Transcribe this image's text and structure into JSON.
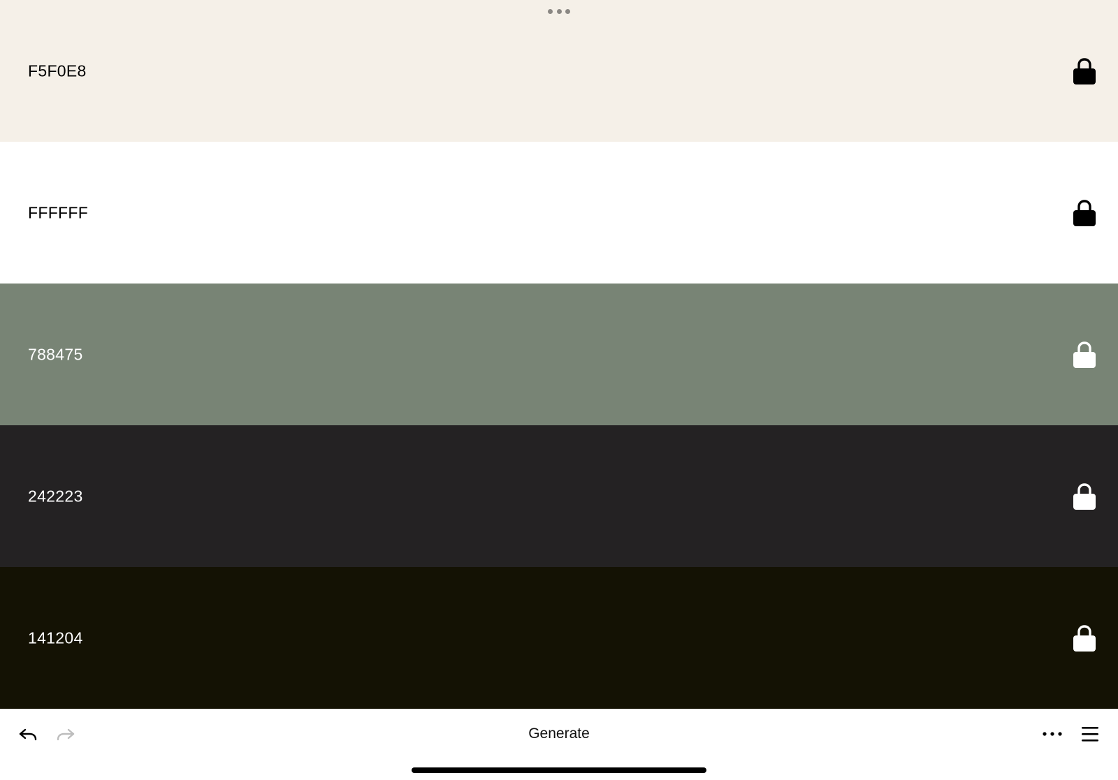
{
  "palette": {
    "swatches": [
      {
        "hex": "F5F0E8",
        "background": "#F5F0E8",
        "text_color": "#000000",
        "locked": true
      },
      {
        "hex": "FFFFFF",
        "background": "#FFFFFF",
        "text_color": "#000000",
        "locked": true
      },
      {
        "hex": "788475",
        "background": "#788475",
        "text_color": "#FFFFFF",
        "locked": true
      },
      {
        "hex": "242223",
        "background": "#242223",
        "text_color": "#FFFFFF",
        "locked": true
      },
      {
        "hex": "141204",
        "background": "#141204",
        "text_color": "#FFFFFF",
        "locked": true
      }
    ],
    "lock_icon": "lock-icon",
    "drag_handle_icon": "more-horizontal-icon"
  },
  "toolbar": {
    "undo_icon": "undo-icon",
    "redo_icon": "redo-icon",
    "redo_enabled": false,
    "generate_label": "Generate",
    "more_icon": "ellipsis-icon",
    "menu_icon": "hamburger-menu-icon"
  }
}
